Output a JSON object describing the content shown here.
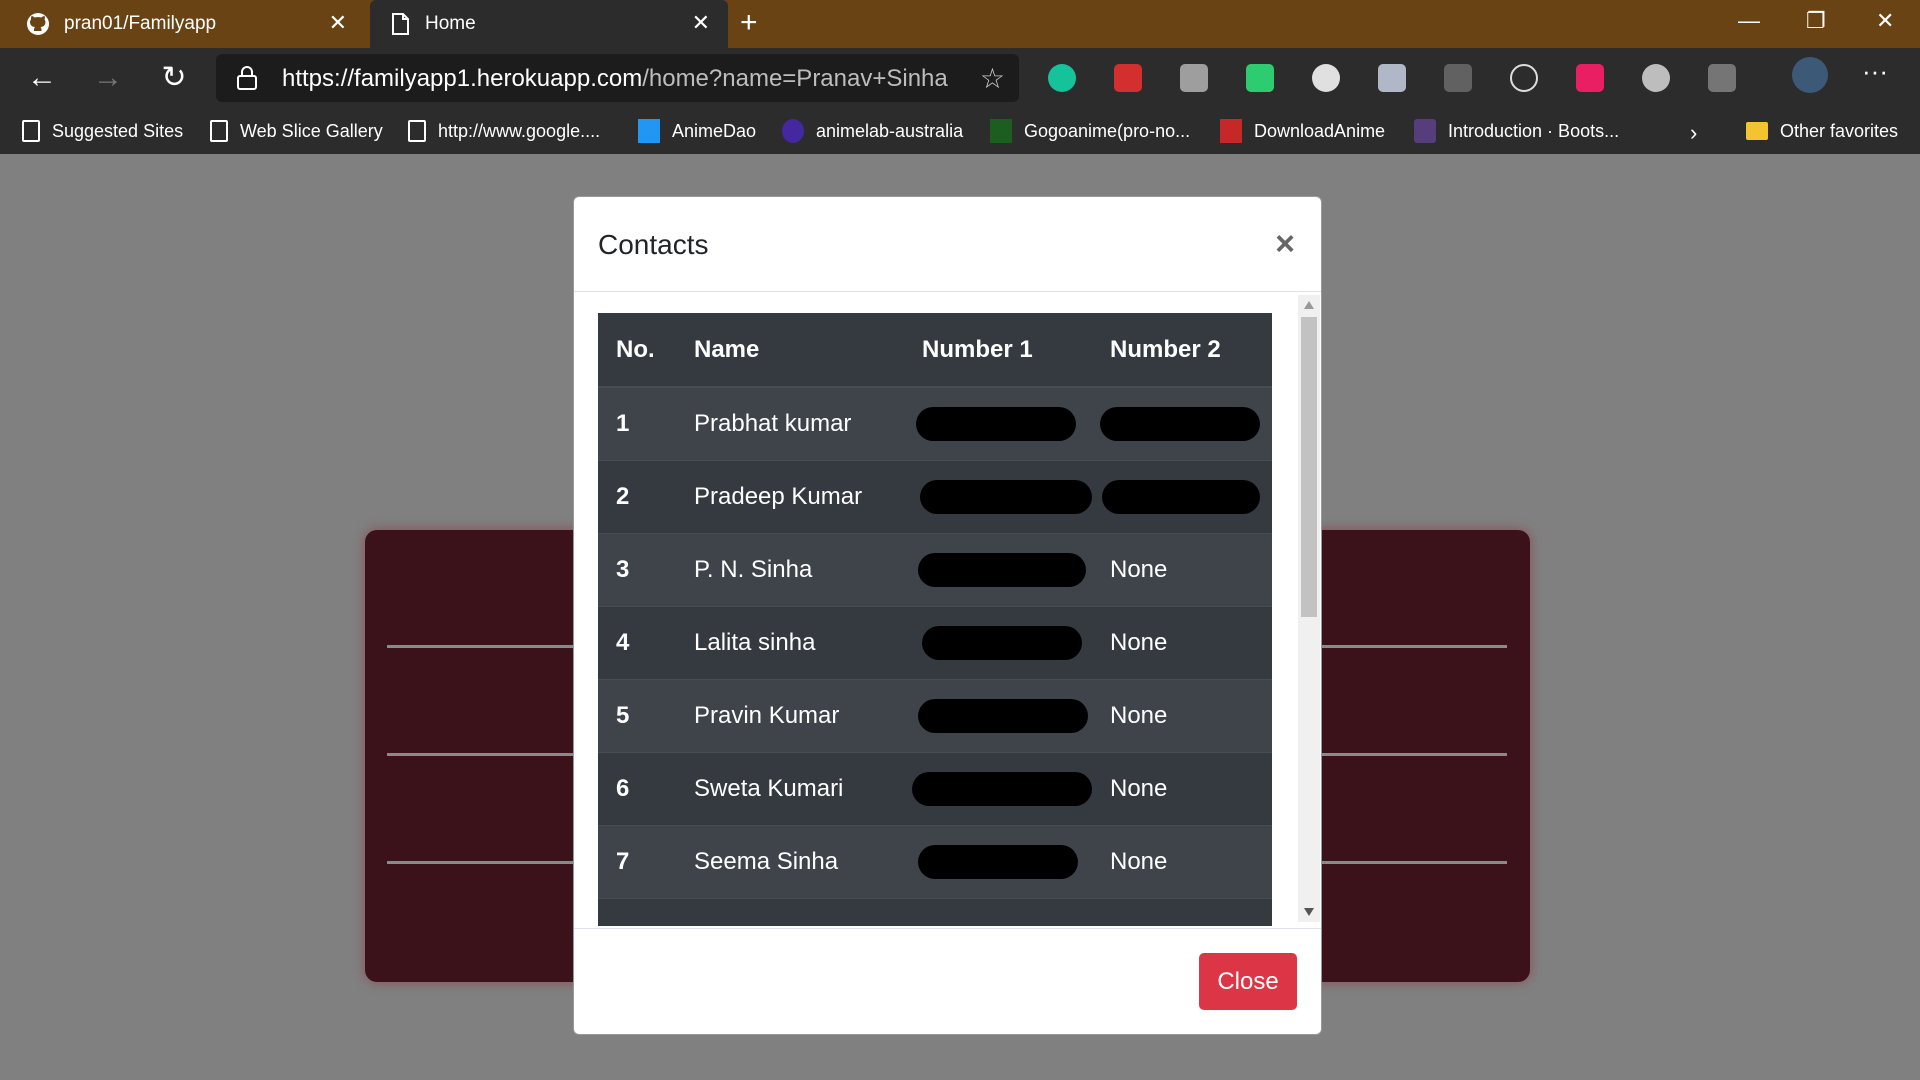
{
  "browser": {
    "tabs": [
      {
        "title": "pran01/Familyapp",
        "icon": "github-icon"
      },
      {
        "title": "Home",
        "icon": "page-icon"
      }
    ],
    "address": {
      "host": "https://familyapp1.herokuapp.com",
      "path": "/home?name=Pranav+Sinha"
    },
    "favorites": [
      {
        "label": "Suggested Sites",
        "icon": "page-icon"
      },
      {
        "label": "Web Slice Gallery",
        "icon": "page-icon"
      },
      {
        "label": "http://www.google....",
        "icon": "page-icon"
      },
      {
        "label": "AnimeDao",
        "icon": "animedao-icon"
      },
      {
        "label": "animelab-australia",
        "icon": "animelab-icon"
      },
      {
        "label": "Gogoanime(pro-no...",
        "icon": "gogoanime-icon"
      },
      {
        "label": "DownloadAnime",
        "icon": "downloadanime-icon"
      },
      {
        "label": "Introduction · Boots...",
        "icon": "bootstrap-icon"
      },
      {
        "label": "Other favorites",
        "icon": "folder-icon"
      }
    ]
  },
  "modal": {
    "title": "Contacts",
    "close_x": "×",
    "close_label": "Close",
    "table": {
      "headers": [
        "No.",
        "Name",
        "Number 1",
        "Number 2"
      ],
      "rows": [
        {
          "no": "1",
          "name": "Prabhat kumar",
          "number1": "",
          "number2": ""
        },
        {
          "no": "2",
          "name": "Pradeep Kumar",
          "number1": "",
          "number2": ""
        },
        {
          "no": "3",
          "name": "P. N. Sinha",
          "number1": "",
          "number2": "None"
        },
        {
          "no": "4",
          "name": "Lalita sinha",
          "number1": "",
          "number2": "None"
        },
        {
          "no": "5",
          "name": "Pravin Kumar",
          "number1": "",
          "number2": "None"
        },
        {
          "no": "6",
          "name": "Sweta Kumari",
          "number1": "",
          "number2": "None"
        },
        {
          "no": "7",
          "name": "Seema Sinha",
          "number1": "",
          "number2": "None"
        }
      ]
    }
  },
  "colors": {
    "titlebar": "#6a4314",
    "toolbar": "#2c2c2c",
    "table_bg": "#343a40",
    "close_button": "#dc3545",
    "bg_card": "#3b121a"
  }
}
